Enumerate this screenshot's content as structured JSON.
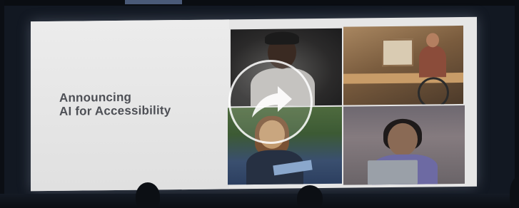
{
  "slide": {
    "headline_line1": "Announcing",
    "headline_line2": "AI for Accessibility"
  },
  "player": {
    "play_icon": "play-arrow-icon"
  },
  "colors": {
    "screen_bg": "#e6e6e6",
    "headline_text": "#4d4f55",
    "room_bg": "#121822"
  }
}
